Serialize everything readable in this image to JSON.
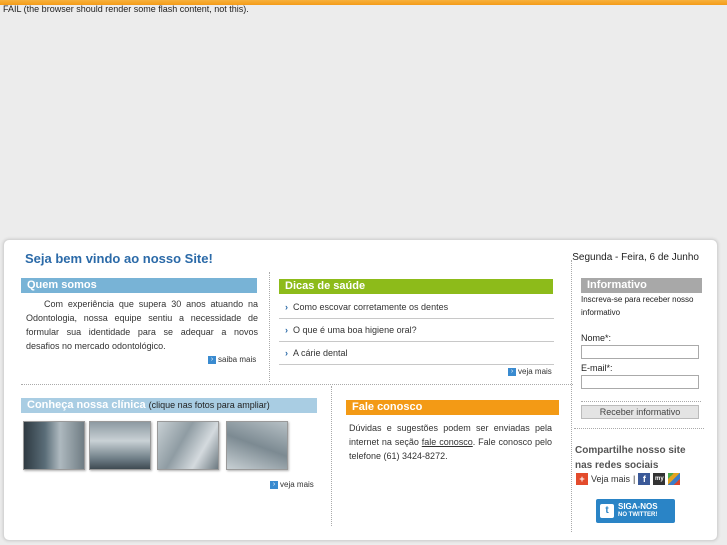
{
  "flash_message": "FAIL (the browser should render some flash content, not this).",
  "header": {
    "welcome": "Seja bem vindo ao nosso Site!",
    "date": "Segunda - Feira, 6 de Junho"
  },
  "quem_somos": {
    "title": "Quem somos",
    "text": "Com experiência que supera 30 anos atuando na Odontologia, nossa equipe sentiu a necessidade de formular sua identidade para se adequar a novos desafios no mercado odontológico.",
    "more": "saiba mais"
  },
  "dicas": {
    "title": "Dicas de saúde",
    "items": [
      {
        "label": "Como escovar corretamente os dentes"
      },
      {
        "label": "O que é uma boa higiene oral?"
      },
      {
        "label": "A cárie dental"
      }
    ],
    "more": "veja mais"
  },
  "conheca": {
    "title": "Conheça nossa clínica",
    "subtitle": "(clique nas fotos para ampliar)",
    "more": "veja mais"
  },
  "fale": {
    "title": "Fale conosco",
    "text_before": "Dúvidas e sugestões podem ser enviadas pela internet na seção ",
    "link": "fale conosco",
    "text_after": ". Fale conosco pelo telefone (61) 3424-8272."
  },
  "informativo": {
    "title": "Informativo",
    "text": "Inscreva-se para receber nosso informativo",
    "nome_label": "Nome*:",
    "email_label": "E-mail*:",
    "nome_value": "",
    "email_value": "",
    "button": "Receber informativo"
  },
  "social": {
    "title": "Compartilhe nosso site nas redes sociais",
    "veja_mais": "Veja mais",
    "separator": "|",
    "twitter_line1": "SIGA-NOS",
    "twitter_line2": "NO TWITTER!"
  }
}
